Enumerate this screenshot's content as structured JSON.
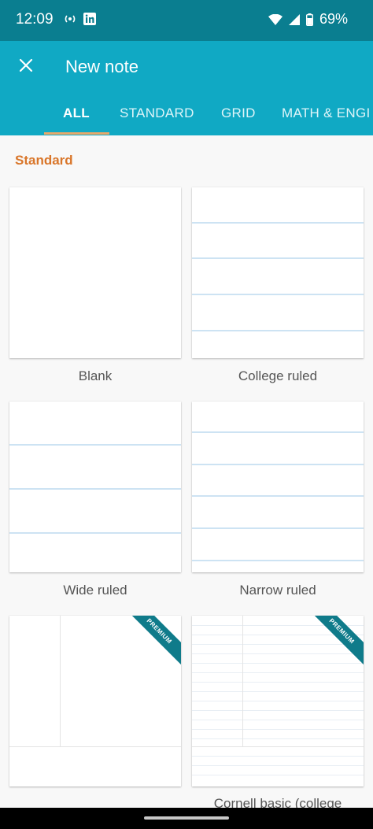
{
  "status_bar": {
    "time": "12:09",
    "icons": [
      "radio-signal-icon",
      "linkedin-icon"
    ],
    "battery": "69%"
  },
  "app_bar": {
    "title": "New note",
    "close_icon": "close-icon",
    "tabs": [
      {
        "label": "ALL",
        "active": true
      },
      {
        "label": "STANDARD",
        "active": false
      },
      {
        "label": "GRID",
        "active": false
      },
      {
        "label": "MATH & ENGI",
        "active": false
      }
    ]
  },
  "section": {
    "title": "Standard"
  },
  "templates": [
    {
      "label": "Blank",
      "premium": false
    },
    {
      "label": "College ruled",
      "premium": false
    },
    {
      "label": "Wide ruled",
      "premium": false
    },
    {
      "label": "Narrow ruled",
      "premium": false
    },
    {
      "label": "",
      "premium": true,
      "badge": "PREMIUM"
    },
    {
      "label": "Cornell basic (college",
      "premium": true,
      "badge": "PREMIUM"
    }
  ],
  "colors": {
    "status_bar": "#0a7e90",
    "app_bar": "#10a9c4",
    "accent": "#d9762a",
    "ruled_line": "#cde3f3",
    "premium_ribbon": "#0f7b8a"
  }
}
